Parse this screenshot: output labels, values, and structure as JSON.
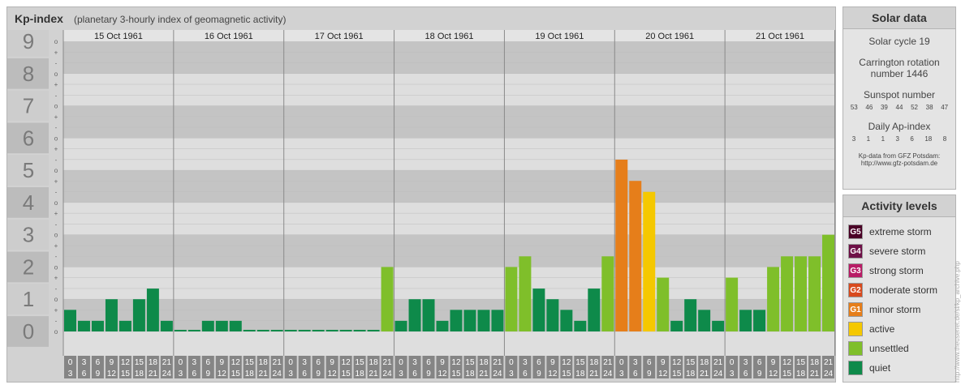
{
  "header": {
    "title": "Kp-index",
    "subtitle": "(planetary 3-hourly index of geomagnetic activity)"
  },
  "chart_data": {
    "type": "bar",
    "title": "Kp-index",
    "ylim": [
      0,
      9
    ],
    "y_major_ticks": [
      "0",
      "1",
      "2",
      "3",
      "4",
      "5",
      "6",
      "7",
      "8",
      "9"
    ],
    "y_minor_ticks": [
      "o",
      "-",
      "+",
      "o",
      "-",
      "+",
      "o",
      "-",
      "+",
      "o",
      "-",
      "+",
      "o",
      "-",
      "+",
      "o",
      "-",
      "+",
      "o",
      "-",
      "+",
      "o",
      "-",
      "+",
      "o",
      "-",
      "+",
      "o"
    ],
    "days": [
      "15 Oct 1961",
      "16 Oct 1961",
      "17 Oct 1961",
      "18 Oct 1961",
      "19 Oct 1961",
      "20 Oct 1961",
      "21 Oct 1961"
    ],
    "interval_start_labels": [
      "0",
      "3",
      "6",
      "9",
      "12",
      "15",
      "18",
      "21"
    ],
    "interval_end_labels": [
      "3",
      "6",
      "9",
      "12",
      "15",
      "18",
      "21",
      "24"
    ],
    "values": [
      [
        0.67,
        0.33,
        0.33,
        1.0,
        0.33,
        1.0,
        1.33,
        0.33
      ],
      [
        0.0,
        0.0,
        0.33,
        0.33,
        0.33,
        0.0,
        0.0,
        0.0
      ],
      [
        0.0,
        0.0,
        0.0,
        0.0,
        0.0,
        0.0,
        0.0,
        2.0
      ],
      [
        0.33,
        1.0,
        1.0,
        0.33,
        0.67,
        0.67,
        0.67,
        0.67
      ],
      [
        2.0,
        2.33,
        1.33,
        1.0,
        0.67,
        0.33,
        1.33,
        2.33
      ],
      [
        5.33,
        4.67,
        4.33,
        1.67,
        0.33,
        1.0,
        0.67,
        0.33
      ],
      [
        1.67,
        0.67,
        0.67,
        2.0,
        2.33,
        2.33,
        2.33,
        3.0
      ]
    ],
    "colors": {
      "quiet": "#0e8a4a",
      "unsettled": "#7fbf2a",
      "active": "#f5c800",
      "minor_storm": "#e67e1a",
      "moderate_storm": "#d84a1e",
      "strong_storm": "#b81c66",
      "severe_storm": "#6e1047",
      "extreme_storm": "#4a0026"
    }
  },
  "solar_panel": {
    "title": "Solar data",
    "solar_cycle": "Solar cycle 19",
    "carrington_label": "Carrington rotation",
    "carrington_number": "number 1446",
    "sunspot_label": "Sunspot number",
    "sunspot_numbers": [
      "53",
      "46",
      "39",
      "44",
      "52",
      "38",
      "47"
    ],
    "ap_label": "Daily Ap-index",
    "ap_numbers": [
      "3",
      "1",
      "1",
      "3",
      "6",
      "18",
      "8"
    ],
    "source_line1": "Kp-data from GFZ Potsdam:",
    "source_line2": "http://www.gfz-potsdam.de"
  },
  "levels_panel": {
    "title": "Activity levels",
    "items": [
      {
        "code": "G5",
        "label": "extreme storm",
        "color": "#4a0026"
      },
      {
        "code": "G4",
        "label": "severe storm",
        "color": "#6e1047"
      },
      {
        "code": "G3",
        "label": "strong storm",
        "color": "#b81c66"
      },
      {
        "code": "G2",
        "label": "moderate storm",
        "color": "#d84a1e"
      },
      {
        "code": "G1",
        "label": "minor storm",
        "color": "#e67e1a"
      },
      {
        "code": "",
        "label": "active",
        "color": "#f5c800"
      },
      {
        "code": "",
        "label": "unsettled",
        "color": "#7fbf2a"
      },
      {
        "code": "",
        "label": "quiet",
        "color": "#0e8a4a"
      }
    ]
  },
  "watermark": "http://www.theusenet.de/sl/kp_archive.php"
}
